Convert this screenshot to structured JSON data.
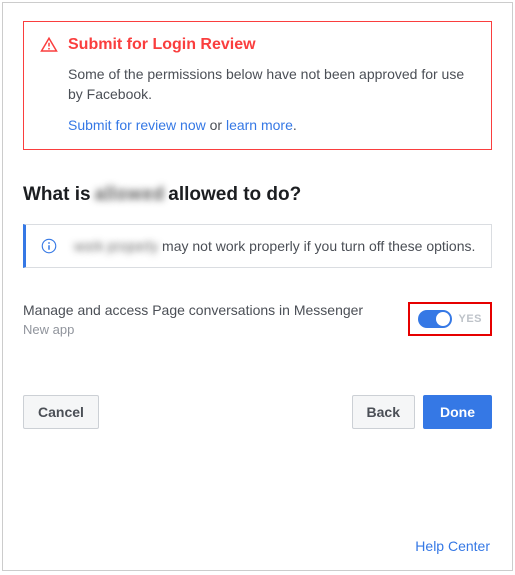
{
  "review": {
    "title": "Submit for Login Review",
    "description": "Some of the permissions below have not been approved for use by Facebook.",
    "submit_link": "Submit for review now",
    "or": " or ",
    "learn_link": "learn more",
    "period": "."
  },
  "heading": {
    "prefix": "What is ",
    "app_name": "allowed",
    "suffix": "allowed to do?"
  },
  "info": {
    "blurred": "work properly",
    "text": "may not work properly if you turn off these options."
  },
  "permission": {
    "title": "Manage and access Page conversations in Messenger",
    "subtitle": "New app",
    "toggle_state": "YES"
  },
  "buttons": {
    "cancel": "Cancel",
    "back": "Back",
    "done": "Done"
  },
  "footer": {
    "help": "Help Center"
  }
}
